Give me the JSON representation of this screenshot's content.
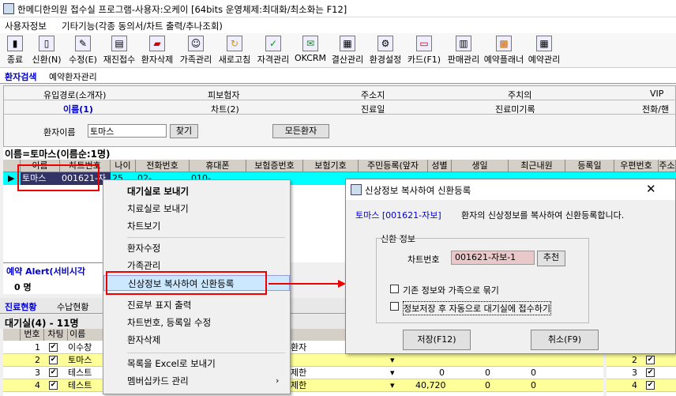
{
  "app": {
    "title": "한메디한의원 접수실 프로그램-사용자:오케이 [64bits 운영체제:최대화/최소화는 F12]"
  },
  "menu": [
    "사용자정보",
    "기타기능(각종 동의서/차트 출력/추나조회)"
  ],
  "toolbar": [
    {
      "label": "종료",
      "icon": "door-icon"
    },
    {
      "label": "신환(N)",
      "icon": "new-patient-icon"
    },
    {
      "label": "수정(E)",
      "icon": "edit-icon"
    },
    {
      "label": "재진접수",
      "icon": "revisit-icon"
    },
    {
      "label": "환자삭제",
      "icon": "delete-patient-icon"
    },
    {
      "label": "가족관리",
      "icon": "family-icon"
    },
    {
      "label": "새로고침",
      "icon": "refresh-icon"
    },
    {
      "label": "자격관리",
      "icon": "qualification-icon"
    },
    {
      "label": "OKCRM",
      "icon": "crm-icon"
    },
    {
      "label": "결산관리",
      "icon": "settlement-icon"
    },
    {
      "label": "환경설정",
      "icon": "settings-icon"
    },
    {
      "label": "카드(F1)",
      "icon": "card-icon"
    },
    {
      "label": "판매관리",
      "icon": "sales-icon"
    },
    {
      "label": "예약플래너",
      "icon": "planner-icon"
    },
    {
      "label": "예약관리",
      "icon": "calendar-icon"
    }
  ],
  "nav_tabs": [
    "환자검색",
    "예약환자관리"
  ],
  "search": {
    "row1": [
      "유입경로(소개자)",
      "피보험자",
      "주소지",
      "주치의",
      "VIP"
    ],
    "row2": [
      "이름(1)",
      "차트(2)",
      "진료일",
      "진료미기록",
      "전화/핸"
    ],
    "name_label": "환자이름",
    "name_value": "토마스",
    "find_btn": "찾기",
    "all_btn": "모든환자"
  },
  "result_title": "이름=토마스(이름순:1명)",
  "grid": {
    "headers": [
      "이름",
      "차트번호",
      "나이",
      "전화번호",
      "휴대폰",
      "보험증번호",
      "보험기호",
      "주민등록(앞자",
      "성별",
      "생일",
      "최근내원",
      "등록일",
      "우편번호",
      "주소"
    ],
    "row": [
      "토마스",
      "001621-자",
      "25",
      "02-...",
      "010-..."
    ]
  },
  "alert": {
    "label": "예약 Alert(서비시각",
    "count": "0 명"
  },
  "bottom_tabs": [
    "진료현황",
    "수납현황"
  ],
  "waiting": {
    "title": "대기실(4) - 11명",
    "headers": [
      "번호",
      "차팅",
      "이름"
    ],
    "rows": [
      {
        "no": "1",
        "name": "이수창",
        "extra": "환자"
      },
      {
        "no": "2",
        "name": "토마스",
        "extra": ""
      },
      {
        "no": "3",
        "name": "테스트",
        "extra": "제한",
        "v1": "0",
        "v2": "0",
        "v3": "0"
      },
      {
        "no": "4",
        "name": "테스트",
        "extra": "제한",
        "v1": "40,720",
        "v2": "0",
        "v3": "0"
      }
    ],
    "right_header": "Be",
    "right_num": "12"
  },
  "context_menu": [
    "대기실로 보내기",
    "치료실로 보내기",
    "차트보기",
    "환자수정",
    "가족관리",
    "신상정보 복사하여 신환등록",
    "진료부 표지 출력",
    "차트번호, 등록일 수정",
    "환자삭제",
    "목록을 Excel로 보내기",
    "멤버십카드 관리"
  ],
  "dialog": {
    "title": "신상정보 복사하여 신환등록",
    "patient": "토마스 [001621-자보]",
    "desc": "환자의 신상정보를 복사하여 신환등록합니다.",
    "group": "신환 정보",
    "chart_label": "차트번호",
    "chart_value": "001621-자보-1",
    "recommend_btn": "추천",
    "opt1": "기존 정보와 가족으로 묶기",
    "opt2": "정보저장 후 자동으로 대기실에 접수하기",
    "save_btn": "저장(F12)",
    "cancel_btn": "취소(F9)"
  },
  "colors": {
    "highlight": "#00ffff",
    "waiting_alt": "#ffff99",
    "red": "#e00000",
    "blue_text": "#0000cc"
  }
}
